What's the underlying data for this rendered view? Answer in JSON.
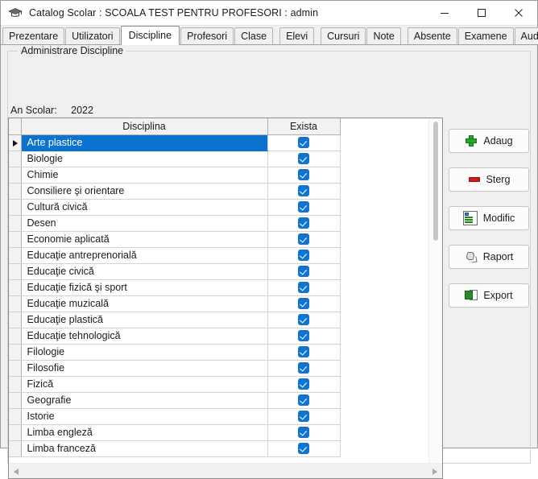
{
  "window": {
    "title": "Catalog Scolar : SCOALA TEST PENTRU PROFESORI : admin",
    "icon": "graduation-cap-icon",
    "controls": {
      "minimize": "minimize-icon",
      "maximize": "maximize-icon",
      "close": "close-icon"
    }
  },
  "tabs": [
    {
      "label": "Prezentare",
      "selected": false
    },
    {
      "label": "Utilizatori",
      "selected": false
    },
    {
      "label": "Discipline",
      "selected": true
    },
    {
      "label": "Profesori",
      "selected": false
    },
    {
      "label": "Clase",
      "selected": false
    },
    {
      "label": "Elevi",
      "selected": false
    },
    {
      "label": "Cursuri",
      "selected": false
    },
    {
      "label": "Note",
      "selected": false
    },
    {
      "label": "Absente",
      "selected": false
    },
    {
      "label": "Examene",
      "selected": false
    },
    {
      "label": "Audit",
      "selected": false
    }
  ],
  "groupbox": {
    "legend": "Administrare Discipline"
  },
  "form": {
    "an_scolar_label": "An Scolar:",
    "an_scolar_value": "2022"
  },
  "grid": {
    "columns": [
      "Disciplina",
      "Exista"
    ],
    "rows": [
      {
        "disciplina": "Arte plastice",
        "exista": true,
        "selected": true
      },
      {
        "disciplina": "Biologie",
        "exista": true,
        "selected": false
      },
      {
        "disciplina": "Chimie",
        "exista": true,
        "selected": false
      },
      {
        "disciplina": "Consiliere şi orientare",
        "exista": true,
        "selected": false
      },
      {
        "disciplina": "Cultură civică",
        "exista": true,
        "selected": false
      },
      {
        "disciplina": "Desen",
        "exista": true,
        "selected": false
      },
      {
        "disciplina": "Economie aplicată",
        "exista": true,
        "selected": false
      },
      {
        "disciplina": "Educaţie antreprenorială",
        "exista": true,
        "selected": false
      },
      {
        "disciplina": "Educaţie civică",
        "exista": true,
        "selected": false
      },
      {
        "disciplina": "Educaţie fizică şi sport",
        "exista": true,
        "selected": false
      },
      {
        "disciplina": "Educaţie muzicală",
        "exista": true,
        "selected": false
      },
      {
        "disciplina": "Educaţie plastică",
        "exista": true,
        "selected": false
      },
      {
        "disciplina": "Educaţie tehnologică",
        "exista": true,
        "selected": false
      },
      {
        "disciplina": "Filologie",
        "exista": true,
        "selected": false
      },
      {
        "disciplina": "Filosofie",
        "exista": true,
        "selected": false
      },
      {
        "disciplina": "Fizică",
        "exista": true,
        "selected": false
      },
      {
        "disciplina": "Geografie",
        "exista": true,
        "selected": false
      },
      {
        "disciplina": "Istorie",
        "exista": true,
        "selected": false
      },
      {
        "disciplina": "Limba engleză",
        "exista": true,
        "selected": false
      },
      {
        "disciplina": "Limba franceză",
        "exista": true,
        "selected": false
      }
    ]
  },
  "actions": [
    {
      "label": "Adaug",
      "icon": "green-plus-icon"
    },
    {
      "label": "Sterg",
      "icon": "red-minus-icon"
    },
    {
      "label": "Modific",
      "icon": "edit-document-icon"
    },
    {
      "label": "Raport",
      "icon": "report-diamond-icon"
    },
    {
      "label": "Export",
      "icon": "excel-export-icon"
    }
  ],
  "colors": {
    "selection": "#0b72d0",
    "checkbox": "#1175d0",
    "accent_add": "#2aa72a",
    "accent_delete": "#d21d1d"
  }
}
